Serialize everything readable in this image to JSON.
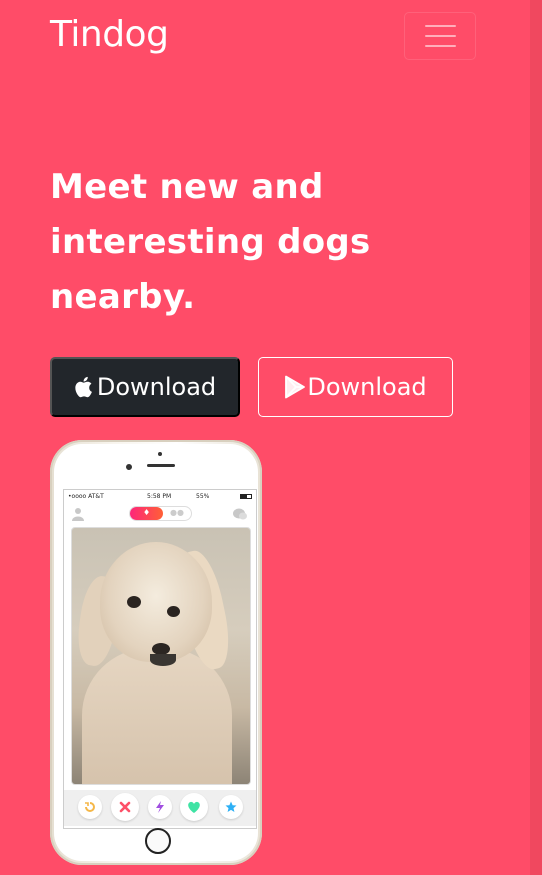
{
  "navbar": {
    "brand": "Tindog",
    "toggler_icon": "hamburger-menu-icon"
  },
  "hero": {
    "title_lines": [
      "Meet new and",
      "interesting dogs",
      "nearby."
    ]
  },
  "buttons": {
    "apple": {
      "label": "Download",
      "icon": "apple-icon"
    },
    "play": {
      "label": "Download",
      "icon": "google-play-icon"
    }
  },
  "phone": {
    "status_bar": {
      "carrier": "•oooo AT&T",
      "time": "5:58 PM",
      "battery": "55%"
    },
    "action_icons": [
      "rewind-icon",
      "nope-x-icon",
      "boost-bolt-icon",
      "like-heart-icon",
      "super-like-star-icon"
    ]
  },
  "colors": {
    "background": "#ff4c68",
    "dark_button": "#22262b",
    "text": "#ffffff"
  }
}
